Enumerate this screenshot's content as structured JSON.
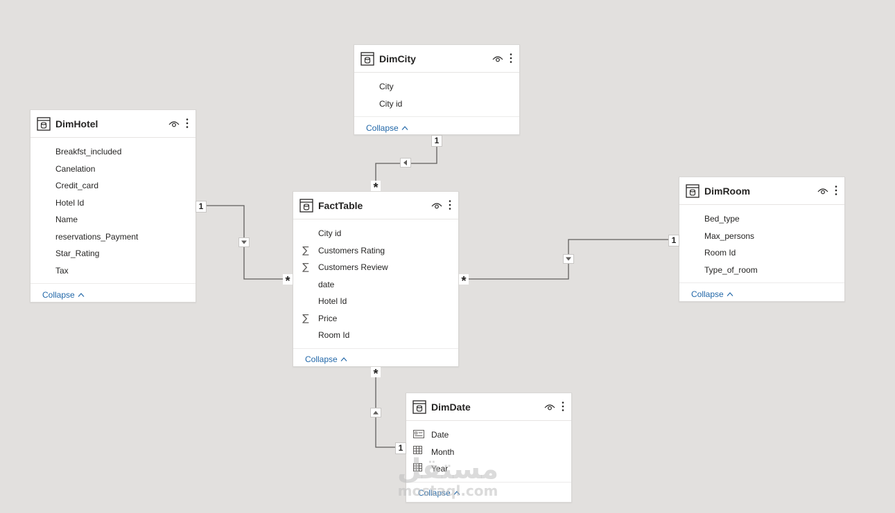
{
  "cards": {
    "dimcity": {
      "title": "DimCity",
      "fields": [
        "City",
        "City id"
      ],
      "collapse": "Collapse"
    },
    "dimhotel": {
      "title": "DimHotel",
      "fields": [
        "Breakfst_included",
        "Canelation",
        "Credit_card",
        "Hotel Id",
        "Name",
        "reservations_Payment",
        "Star_Rating",
        "Tax"
      ],
      "collapse": "Collapse"
    },
    "facttable": {
      "title": "FactTable",
      "fields": [
        "City id",
        "Customers Rating",
        "Customers Review",
        "date",
        "Hotel Id",
        "Price",
        "Room Id"
      ],
      "sum_fields": [
        "Customers Rating",
        "Customers Review",
        "Price"
      ],
      "collapse": "Collapse"
    },
    "dimroom": {
      "title": "DimRoom",
      "fields": [
        "Bed_type",
        "Max_persons",
        "Room Id",
        "Type_of_room"
      ],
      "collapse": "Collapse"
    },
    "dimdate": {
      "title": "DimDate",
      "fields": [
        "Date",
        "Month",
        "Year"
      ],
      "collapse": "Collapse"
    }
  },
  "relationships": {
    "one": "1",
    "many": "*"
  },
  "watermark": {
    "main": "مستقل",
    "sub": "mostaql.com"
  },
  "colors": {
    "canvas": "#e2e0de",
    "card": "#ffffff",
    "link": "#2167a8",
    "line": "#605e5c"
  }
}
